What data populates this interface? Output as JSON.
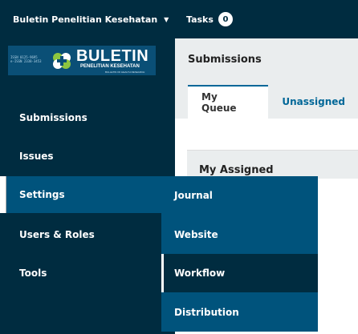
{
  "topbar": {
    "context_name": "Buletin Penelitian Kesehatan",
    "context_caret": "▼",
    "tasks_label": "Tasks",
    "tasks_count": "0"
  },
  "logo": {
    "strip_line1": "ISSN 0125-9695",
    "strip_line2": "e-ISSN 2338-3453",
    "title": "BULETIN",
    "subtitle": "PENELITIAN KESEHATAN",
    "tagline": "BULLETIN OF HEALTH RESEARCH"
  },
  "sidebar": {
    "items": [
      {
        "label": "Submissions"
      },
      {
        "label": "Issues"
      },
      {
        "label": "Settings",
        "active": true
      },
      {
        "label": "Users & Roles"
      },
      {
        "label": "Tools"
      }
    ]
  },
  "main": {
    "title": "Submissions",
    "tabs": [
      {
        "label": "My Queue",
        "selected": true
      },
      {
        "label": "Unassigned"
      }
    ],
    "section_title": "My Assigned"
  },
  "submenu": {
    "items": [
      {
        "label": "Journal"
      },
      {
        "label": "Website"
      },
      {
        "label": "Workflow",
        "hovered": true
      },
      {
        "label": "Distribution"
      }
    ]
  },
  "colors": {
    "dark_navy": "#002c40",
    "accent_blue": "#006798",
    "active_blue": "#00537c",
    "light_gray": "#eaedee"
  },
  "icons": {
    "dropdown": "caret-down-icon",
    "logo_mark": "clover-cross-logo-icon"
  }
}
